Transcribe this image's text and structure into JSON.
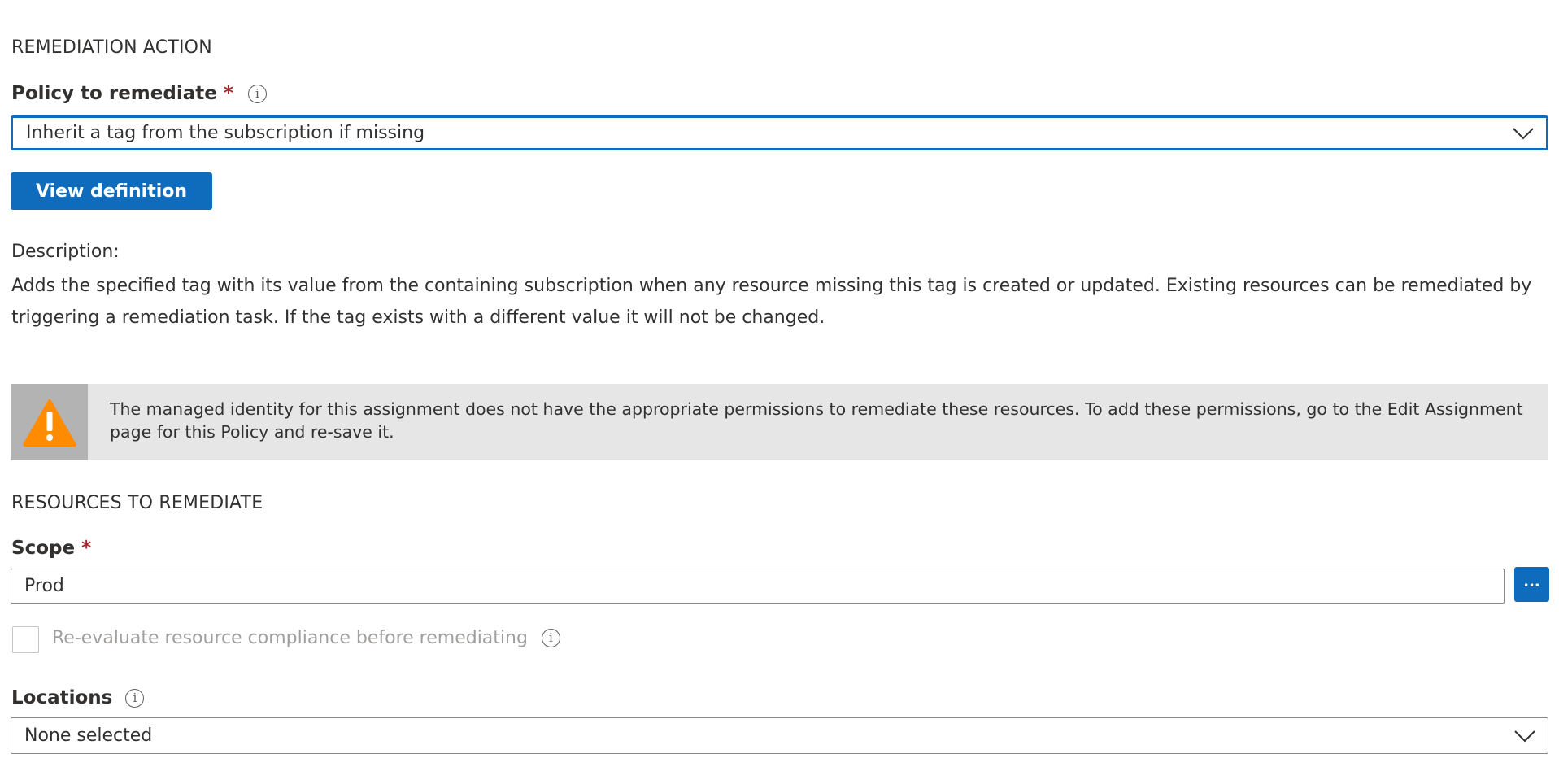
{
  "remediation_action": {
    "section_title": "REMEDIATION ACTION",
    "policy_label": "Policy to remediate",
    "required_marker": "*",
    "policy_value": "Inherit a tag from the subscription if missing",
    "view_definition_label": "View definition",
    "description_label": "Description:",
    "description_text": "Adds the specified tag with its value from the containing subscription when any resource missing this tag is created or updated. Existing resources can be remediated by triggering a remediation task. If the tag exists with a different value it will not be changed."
  },
  "warning": {
    "icon": "warning-icon",
    "icon_color": "#ff8c00",
    "message": "The managed identity for this assignment does not have the appropriate permissions to remediate these resources. To add these permissions, go to the Edit Assignment page for this Policy and re-save it."
  },
  "resources": {
    "section_title": "RESOURCES TO REMEDIATE",
    "scope_label": "Scope",
    "required_marker": "*",
    "scope_value": "Prod",
    "scope_browse_label": "...",
    "reevaluate_label": "Re-evaluate resource compliance before remediating",
    "reevaluate_checked": false,
    "locations_label": "Locations",
    "locations_value": "None selected"
  },
  "colors": {
    "accent": "#0f6cbd",
    "required": "#a4262c",
    "warning_bg": "#e6e6e6"
  }
}
